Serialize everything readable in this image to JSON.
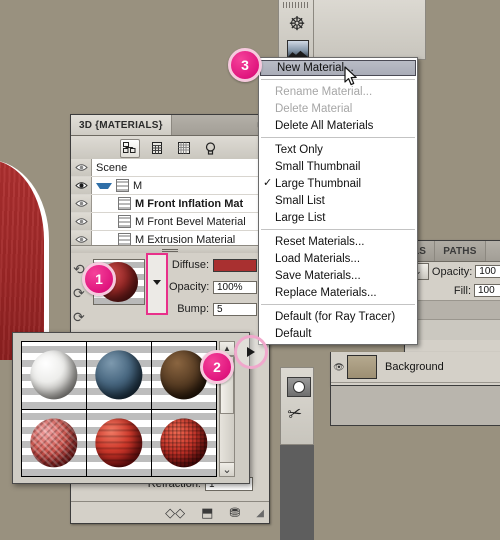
{
  "app": {
    "background_color": "#99917f",
    "accent_pink": "#e8308a"
  },
  "materials_panel": {
    "tab_label": "3D {MATERIALS}",
    "menu_glyph": "▸▸",
    "toolbar": [
      {
        "name": "scene-icon",
        "glyph": "⎇",
        "active": true
      },
      {
        "name": "mesh-icon",
        "glyph": "▦",
        "active": false
      },
      {
        "name": "materials-icon",
        "glyph": "▦",
        "active": false
      },
      {
        "name": "light-icon",
        "glyph": "⚬",
        "active": false
      }
    ],
    "tree": [
      {
        "label": "Scene",
        "indent": 0,
        "selected": false,
        "has_chip": false,
        "has_arrow": false
      },
      {
        "label": "M",
        "indent": 0,
        "selected": false,
        "has_chip": true,
        "has_arrow": true
      },
      {
        "label": "M Front Inflation Mat",
        "indent": 2,
        "selected": true,
        "has_chip": true,
        "has_arrow": false
      },
      {
        "label": "M Front Bevel Material",
        "indent": 2,
        "selected": false,
        "has_chip": true,
        "has_arrow": false
      },
      {
        "label": "M Extrusion Material",
        "indent": 2,
        "selected": false,
        "has_chip": true,
        "has_arrow": false
      }
    ],
    "properties": {
      "diffuse_label": "Diffuse:",
      "diffuse_color": "#a93030",
      "opacity_label": "Opacity:",
      "opacity_value": "100%",
      "bump_label": "Bump:",
      "bump_value": "5",
      "refraction_label": "Refraction:",
      "refraction_value": "1"
    },
    "footer_icons": [
      {
        "name": "new-material-icon",
        "glyph": "◩"
      },
      {
        "name": "duplicate-layer-icon",
        "glyph": "⬒"
      },
      {
        "name": "trash-icon",
        "glyph": "Ὕ1"
      }
    ]
  },
  "context_menu": {
    "items": [
      {
        "label": "New Material...",
        "state": "highlighted",
        "checked": false
      },
      {
        "separator": true
      },
      {
        "label": "Rename Material...",
        "state": "disabled",
        "checked": false
      },
      {
        "label": "Delete Material",
        "state": "disabled",
        "checked": false
      },
      {
        "label": "Delete All Materials",
        "state": "normal",
        "checked": false
      },
      {
        "separator": true
      },
      {
        "label": "Text Only",
        "state": "normal",
        "checked": false
      },
      {
        "label": "Small Thumbnail",
        "state": "normal",
        "checked": false
      },
      {
        "label": "Large Thumbnail",
        "state": "normal",
        "checked": true
      },
      {
        "label": "Small List",
        "state": "normal",
        "checked": false
      },
      {
        "label": "Large List",
        "state": "normal",
        "checked": false
      },
      {
        "separator": true
      },
      {
        "label": "Reset Materials...",
        "state": "normal",
        "checked": false
      },
      {
        "label": "Load Materials...",
        "state": "normal",
        "checked": false
      },
      {
        "label": "Save Materials...",
        "state": "normal",
        "checked": false
      },
      {
        "label": "Replace Materials...",
        "state": "normal",
        "checked": false
      },
      {
        "separator": true
      },
      {
        "label": "Default (for Ray Tracer)",
        "state": "normal",
        "checked": false
      },
      {
        "label": "Default",
        "state": "normal",
        "checked": false
      }
    ],
    "check_glyph": "✓"
  },
  "swatch_popup": {
    "swatches": [
      {
        "name": "white-marble-sphere",
        "color_a": "#f2f1ef",
        "color_b": "#9e9c98"
      },
      {
        "name": "blue-steel-sphere",
        "color_a": "#4b6a83",
        "color_b": "#1d3347"
      },
      {
        "name": "dark-wood-sphere",
        "color_a": "#6d4f33",
        "color_b": "#2a1a0d"
      },
      {
        "name": "red-glitter-sphere",
        "color_a": "#e98686",
        "color_b": "#a32020"
      },
      {
        "name": "red-wave-sphere",
        "color_a": "#e04a3c",
        "color_b": "#8e1010"
      },
      {
        "name": "red-mosaic-sphere",
        "color_a": "#d94a3a",
        "color_b": "#5e0d0d"
      }
    ],
    "scroll_down_glyph": "⌄"
  },
  "right_panel": {
    "tabs": [
      {
        "label": "LS",
        "active": false
      },
      {
        "label": "PATHS",
        "active": false
      }
    ],
    "opacity_label": "Opacity:",
    "opacity_value": "100",
    "fill_label": "Fill:",
    "fill_value": "100",
    "chevron_glyph": "⌄",
    "layer_name": "Background"
  },
  "dock": {
    "icons": [
      {
        "name": "camera-orbit-icon",
        "glyph": "☸"
      },
      {
        "name": "image-thumbnail-icon",
        "glyph": "⛰"
      },
      {
        "name": "record-button-icon",
        "glyph": "◉"
      },
      {
        "name": "tools-icon",
        "glyph": "✂"
      }
    ]
  },
  "step_badges": [
    {
      "number": "1",
      "name": "step-badge-1"
    },
    {
      "number": "2",
      "name": "step-badge-2"
    },
    {
      "number": "3",
      "name": "step-badge-3"
    }
  ]
}
